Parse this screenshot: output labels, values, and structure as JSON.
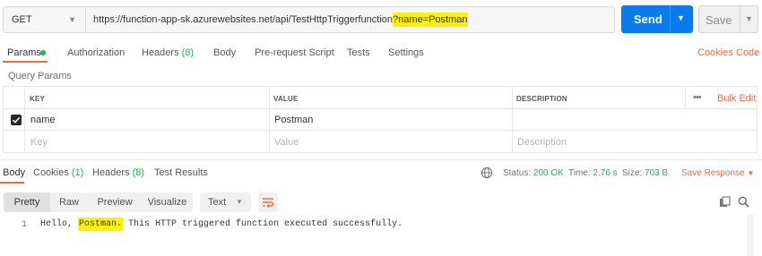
{
  "request": {
    "method": "GET",
    "url_base": "https://function-app-sk.azurewebsites.net/api/TestHttpTriggerfunction",
    "url_query": "?name=Postman",
    "send_label": "Send",
    "save_label": "Save"
  },
  "request_tabs": {
    "params": "Params",
    "authorization": "Authorization",
    "headers": "Headers",
    "headers_count": "(8)",
    "body": "Body",
    "pre_request_script": "Pre-request Script",
    "tests": "Tests",
    "settings": "Settings",
    "cookies": "Cookies",
    "code": "Code"
  },
  "query_params": {
    "title": "Query Params",
    "columns": {
      "key": "KEY",
      "value": "VALUE",
      "description": "DESCRIPTION"
    },
    "bulk_edit": "Bulk Edit",
    "more": "•••",
    "rows": [
      {
        "key": "name",
        "value": "Postman",
        "description": "",
        "checked": true
      }
    ],
    "placeholder": {
      "key": "Key",
      "value": "Value",
      "description": "Description"
    }
  },
  "response_tabs": {
    "body": "Body",
    "cookies": "Cookies",
    "cookies_count": "(1)",
    "headers": "Headers",
    "headers_count": "(8)",
    "test_results": "Test Results"
  },
  "response_status": {
    "status_label": "Status:",
    "status_value": "200 OK",
    "time_label": "Time:",
    "time_value": "2.76 s",
    "size_label": "Size:",
    "size_value": "703 B",
    "save_response": "Save Response"
  },
  "body_view": {
    "modes": [
      "Pretty",
      "Raw",
      "Preview",
      "Visualize"
    ],
    "format": "Text"
  },
  "response_body": {
    "line_number": "1",
    "text_before": "Hello, ",
    "highlight": "Postman.",
    "text_after": " This HTTP triggered function executed successfully."
  },
  "colors": {
    "accent_orange": "#f26b3a",
    "send_blue": "#097bed",
    "status_green": "#0cbb52",
    "highlight_yellow": "#fff200"
  },
  "icons": [
    "chevron-down-icon",
    "checkbox-checked-icon",
    "more-icon",
    "globe-icon",
    "wrap-lines-icon",
    "copy-icon",
    "search-icon"
  ]
}
